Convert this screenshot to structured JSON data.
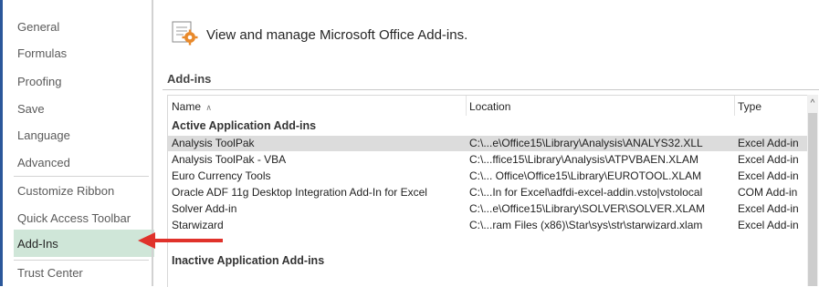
{
  "nav": {
    "items": [
      {
        "label": "General",
        "selected": false
      },
      {
        "label": "Formulas",
        "selected": false
      },
      {
        "label": "Proofing",
        "selected": false
      },
      {
        "label": "Save",
        "selected": false
      },
      {
        "label": "Language",
        "selected": false
      },
      {
        "label": "Advanced",
        "selected": false
      },
      {
        "label": "Customize Ribbon",
        "selected": false
      },
      {
        "label": "Quick Access Toolbar",
        "selected": false
      },
      {
        "label": "Add-Ins",
        "selected": true
      },
      {
        "label": "Trust Center",
        "selected": false
      }
    ]
  },
  "header": {
    "icon": "addins-gear-icon",
    "text": "View and manage Microsoft Office Add-ins."
  },
  "section": {
    "title": "Add-ins"
  },
  "table": {
    "columns": {
      "name": "Name",
      "sort_glyph": "∧",
      "location": "Location",
      "type": "Type"
    },
    "active_group": "Active Application Add-ins",
    "rows": [
      {
        "name": "Analysis ToolPak",
        "location": "C:\\...e\\Office15\\Library\\Analysis\\ANALYS32.XLL",
        "type": "Excel Add-in",
        "selected": true
      },
      {
        "name": "Analysis ToolPak - VBA",
        "location": "C:\\...ffice15\\Library\\Analysis\\ATPVBAEN.XLAM",
        "type": "Excel Add-in",
        "selected": false
      },
      {
        "name": "Euro Currency Tools",
        "location": "C:\\... Office\\Office15\\Library\\EUROTOOL.XLAM",
        "type": "Excel Add-in",
        "selected": false
      },
      {
        "name": "Oracle ADF 11g Desktop Integration Add-In for Excel",
        "location": "C:\\...In for Excel\\adfdi-excel-addin.vsto|vstolocal",
        "type": "COM Add-in",
        "selected": false
      },
      {
        "name": "Solver Add-in",
        "location": "C:\\...e\\Office15\\Library\\SOLVER\\SOLVER.XLAM",
        "type": "Excel Add-in",
        "selected": false
      },
      {
        "name": "Starwizard",
        "location": "C:\\...ram Files (x86)\\Star\\sys\\str\\starwizard.xlam",
        "type": "Excel Add-in",
        "selected": false
      }
    ],
    "inactive_group": "Inactive Application Add-ins"
  },
  "scrollbar": {
    "up_glyph": "^"
  },
  "annotation": {
    "arrow_color": "#e0322b"
  },
  "colors": {
    "accent": "#2b579a",
    "nav_selected_bg": "#cfe6d8",
    "row_selected_bg": "#dcdcdc"
  }
}
